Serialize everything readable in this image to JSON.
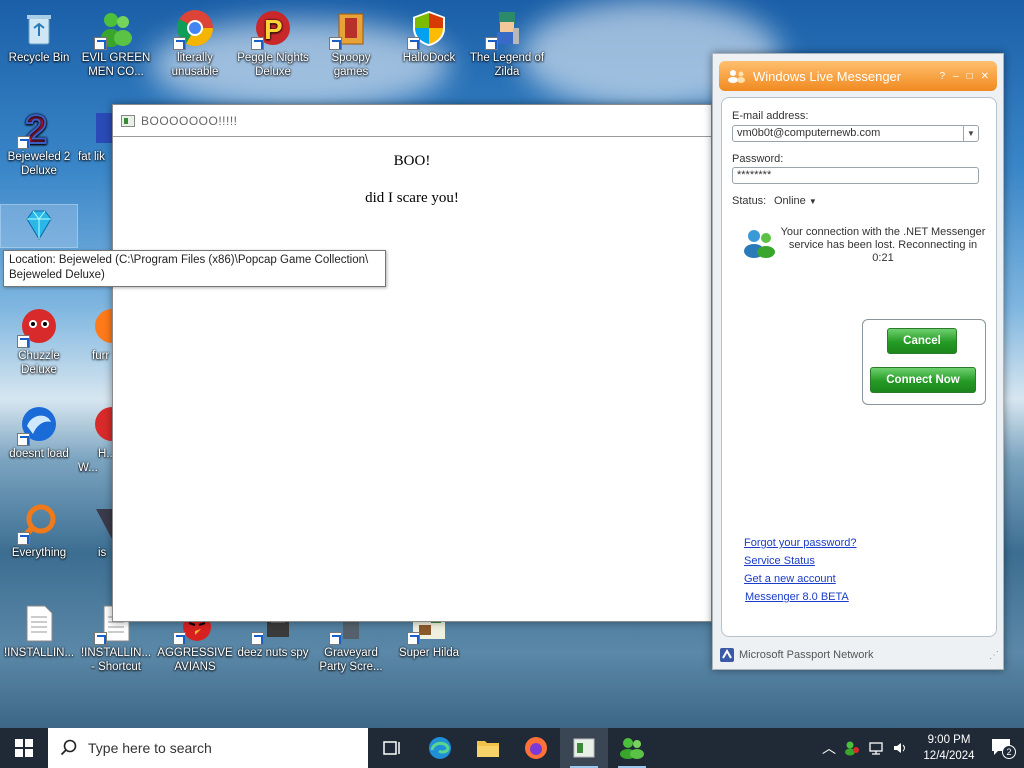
{
  "desktop": {
    "icons": [
      {
        "label": "Recycle Bin"
      },
      {
        "label": "EVIL GREEN MEN CO..."
      },
      {
        "label": "literally unusable"
      },
      {
        "label": "Peggle Nights Deluxe"
      },
      {
        "label": "Spoopy games"
      },
      {
        "label": "HalloDock"
      },
      {
        "label": "The Legend of Zilda"
      },
      {
        "label": "Bejeweled 2 Deluxe"
      },
      {
        "label": "fat lik"
      },
      {
        "label": "Chuzzle Deluxe"
      },
      {
        "label": "furr"
      },
      {
        "label": "doesnt load"
      },
      {
        "label": "H... W..."
      },
      {
        "label": "Everything"
      },
      {
        "label": "is"
      },
      {
        "label": "!INSTALLIN..."
      },
      {
        "label": "!INSTALLIN... - Shortcut"
      },
      {
        "label": "AGGRESSIVE AVIANS"
      },
      {
        "label": "deez nuts spy"
      },
      {
        "label": "Graveyard Party Scre..."
      },
      {
        "label": "Super Hilda"
      }
    ]
  },
  "tooltip": {
    "text": "Location: Bejeweled (C:\\Program Files (x86)\\Popcap Game Collection\\ Bejeweled Deluxe)"
  },
  "boo_window": {
    "title": "BOOOOOOO!!!!!",
    "line1": "BOO!",
    "line2": "did I scare you!"
  },
  "messenger": {
    "title": "Windows Live Messenger",
    "email_label": "E-mail address:",
    "email_value": "vm0b0t@computernewb.com",
    "password_label": "Password:",
    "password_value": "********",
    "status_label": "Status:",
    "status_value": "Online",
    "message": "Your connection with the .NET Messenger service has been lost. Reconnecting in 0:21",
    "cancel_label": "Cancel",
    "connect_label": "Connect Now",
    "links": [
      "Forgot your password?",
      "Service Status",
      "Get a new account",
      "Messenger 8.0 BETA"
    ],
    "footer": "Microsoft Passport Network"
  },
  "taskbar": {
    "search_placeholder": "Type here to search",
    "time": "9:00 PM",
    "date": "12/4/2024",
    "notification_count": "2"
  }
}
